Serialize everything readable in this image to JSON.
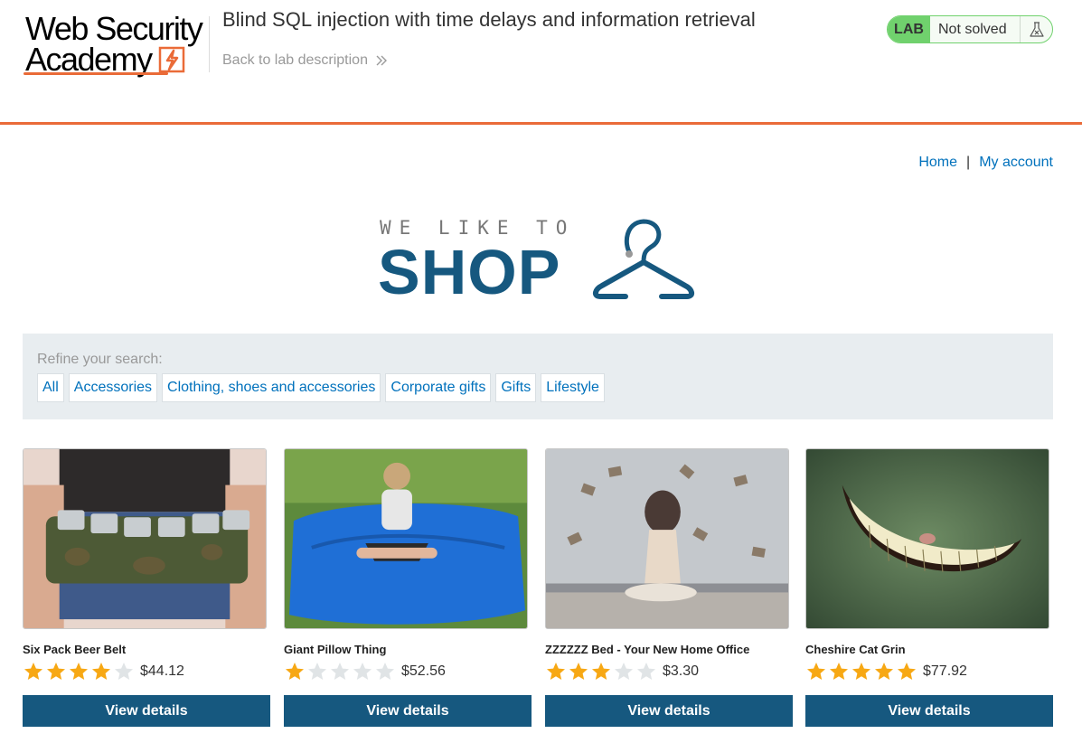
{
  "academy": {
    "logo_line1": "Web Security",
    "logo_line2": "Academy",
    "lab_title": "Blind SQL injection with time delays and information retrieval",
    "back_link": "Back to lab description",
    "status_badge": "LAB",
    "status_text": "Not solved"
  },
  "nav": {
    "home": "Home",
    "separator": "|",
    "account": "My account"
  },
  "banner": {
    "tagline": "WE LIKE TO",
    "word": "SHOP"
  },
  "filter": {
    "label": "Refine your search:",
    "categories": [
      "All",
      "Accessories",
      "Clothing, shoes and accessories",
      "Corporate gifts",
      "Gifts",
      "Lifestyle"
    ]
  },
  "products": [
    {
      "name": "Six Pack Beer Belt",
      "rating": 4,
      "price": "$44.12",
      "button": "View details"
    },
    {
      "name": "Giant Pillow Thing",
      "rating": 1,
      "price": "$52.56",
      "button": "View details"
    },
    {
      "name": "ZZZZZZ Bed - Your New Home Office",
      "rating": 3,
      "price": "$3.30",
      "button": "View details"
    },
    {
      "name": "Cheshire Cat Grin",
      "rating": 5,
      "price": "$77.92",
      "button": "View details"
    }
  ],
  "colors": {
    "accent": "#ea6b38",
    "brand": "#16587f",
    "link": "#0071bc",
    "status_green": "#70d16d",
    "star_filled": "#f7a814",
    "star_empty": "#e0e4e6"
  }
}
